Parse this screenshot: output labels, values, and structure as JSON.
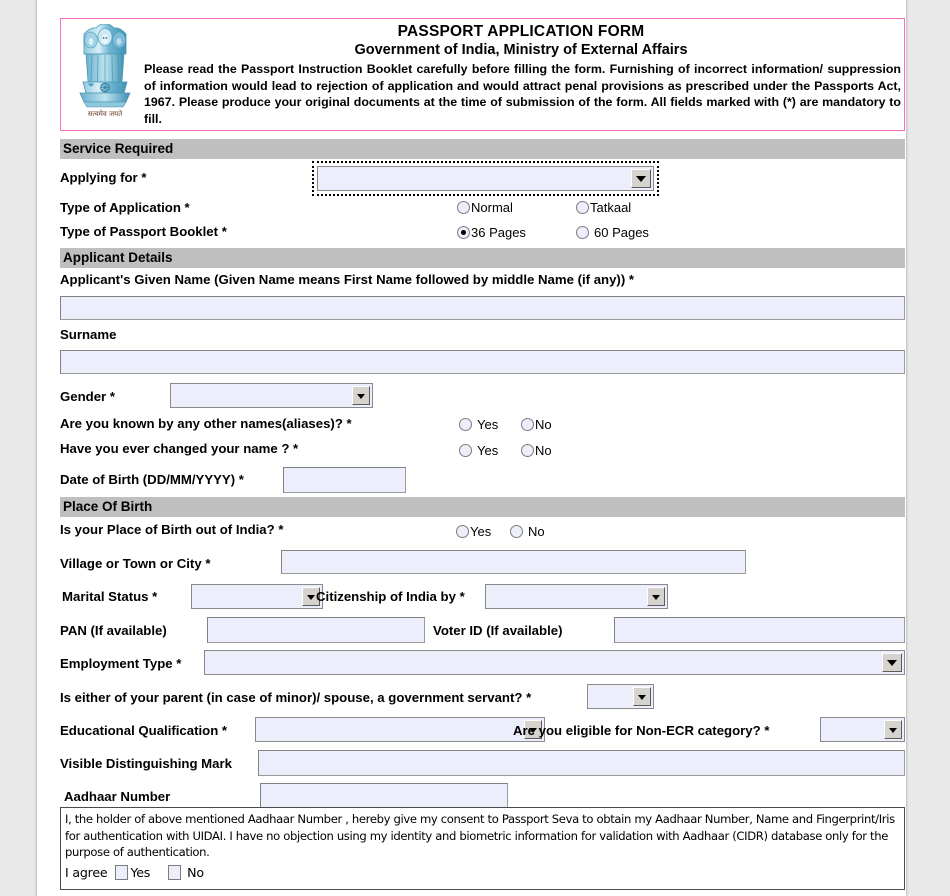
{
  "header": {
    "title": "PASSPORT APPLICATION FORM",
    "subtitle": "Government of India, Ministry of External Affairs",
    "paragraph": "Please read the Passport Instruction Booklet carefully before filling the form. Furnishing of incorrect information/ suppression of information would lead to rejection of application and would attract penal provisions as prescribed under the Passports Act, 1967. Please produce your original documents at the time of submission of the form. All fields marked with (*) are mandatory to fill.",
    "emblem_icon": "india-national-emblem-icon",
    "emblem_motto": "सत्यमेव जयते",
    "border_color": "#ff6fbf"
  },
  "sections": {
    "service_required": "Service Required",
    "applicant_details": "Applicant Details",
    "place_of_birth": "Place Of Birth"
  },
  "service": {
    "applying_for_label": "Applying for *",
    "applying_for_value": "",
    "type_of_application_label": "Type of Application *",
    "application_options": [
      {
        "label": "Normal",
        "checked": false
      },
      {
        "label": "Tatkaal",
        "checked": false
      }
    ],
    "booklet_label": "Type of Passport Booklet *",
    "booklet_options": [
      {
        "label": "36 Pages",
        "checked": true
      },
      {
        "label": "60 Pages",
        "checked": false
      }
    ]
  },
  "applicant": {
    "given_name_label": "Applicant's Given Name (Given Name means First Name followed by middle Name (if any)) *",
    "given_name_value": "",
    "surname_label": "Surname",
    "surname_value": "",
    "gender_label": "Gender *",
    "gender_value": "",
    "aliases_label": "Are you known by any other names(aliases)? *",
    "aliases_yes": "Yes",
    "aliases_no": "No",
    "changed_name_label": "Have you ever changed your name ? *",
    "changed_name_yes": "Yes",
    "changed_name_no": "No",
    "dob_label": "Date of Birth (DD/MM/YYYY) *",
    "dob_value": ""
  },
  "birth": {
    "out_of_india_label": "Is your Place of Birth out of India? *",
    "out_of_india_yes": "Yes",
    "out_of_india_no": "No",
    "village_label": "Village or Town or City *",
    "village_value": "",
    "marital_label": "Marital Status *",
    "marital_value": "",
    "citizenship_label": "Citizenship of India by *",
    "citizenship_value": "",
    "pan_label": "PAN (If available)",
    "pan_value": "",
    "voter_label": "Voter ID (If available)",
    "voter_value": "",
    "employment_label": "Employment Type *",
    "employment_value": "",
    "govt_servant_label": "Is either of your parent (in case of minor)/ spouse, a government servant? *",
    "govt_servant_value": "",
    "education_label": "Educational Qualification *",
    "education_value": "",
    "non_ecr_label": "Are you eligible for Non-ECR category? *",
    "non_ecr_value": "",
    "mark_label": "Visible Distinguishing Mark",
    "mark_value": "",
    "aadhaar_label": "Aadhaar Number",
    "aadhaar_value": ""
  },
  "consent": {
    "text": "I, the holder of above mentioned Aadhaar Number , hereby give my consent to Passport Seva to obtain my Aadhaar Number, Name and Fingerprint/Iris for authentication with UIDAI. I have no objection using my identity and biometric information for validation with Aadhaar (CIDR) database only for the purpose of authentication.",
    "agree_label": "I agree",
    "yes_label": "Yes",
    "no_label": "No",
    "yes_checked": false,
    "no_checked": false
  },
  "colors": {
    "page_background": "#ffffff",
    "app_background": "#e9e9e9",
    "section_bar": "#bfbfbf",
    "input_fill": "#eceefb",
    "input_border": "#8a8a8a"
  }
}
